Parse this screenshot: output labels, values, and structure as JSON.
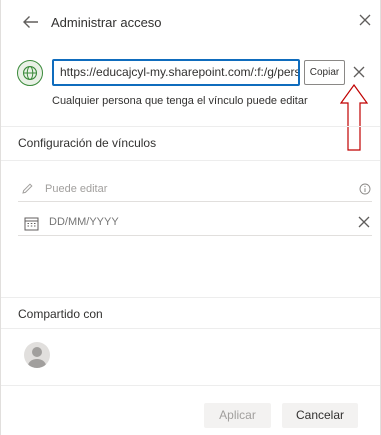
{
  "header": {
    "title": "Administrar acceso"
  },
  "link": {
    "url": "https://educajcyl-my.sharepoint.com/:f:/g/persc",
    "copy_label": "Copiar",
    "description": "Cualquier persona que tenga el vínculo puede editar"
  },
  "link_settings": {
    "title": "Configuración de vínculos",
    "permission_label": "Puede editar",
    "date_placeholder": "DD/MM/YYYY"
  },
  "shared_with": {
    "title": "Compartido con"
  },
  "footer": {
    "apply_label": "Aplicar",
    "cancel_label": "Cancelar"
  },
  "icons": {
    "back": "back-arrow-icon",
    "close": "close-icon",
    "globe": "globe-icon",
    "pencil": "pencil-icon",
    "info": "info-icon",
    "calendar": "calendar-icon",
    "avatar": "person-avatar-icon",
    "annotation": "red-up-arrow-annotation"
  },
  "colors": {
    "accent": "#0f6cbd",
    "globe": "#3a8a3a",
    "annotation": "#c00000"
  }
}
